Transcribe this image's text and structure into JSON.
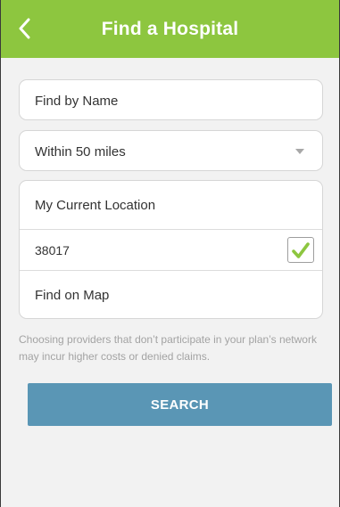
{
  "header": {
    "title": "Find a Hospital",
    "back_icon": "chevron-left-icon",
    "color": "#8dc63f"
  },
  "form": {
    "name_placeholder": "Find by Name",
    "distance_selected": "Within 50 miles",
    "location_label": "My Current Location",
    "zip_value": "38017",
    "zip_checked": true,
    "map_label": "Find on Map"
  },
  "disclaimer": "Choosing providers that don’t participate in your plan’s network may incur higher costs or denied claims.",
  "search_button": {
    "label": "SEARCH",
    "color": "#5a96b5"
  },
  "colors": {
    "check_green": "#8dc63f",
    "background": "#f2f2f2"
  }
}
